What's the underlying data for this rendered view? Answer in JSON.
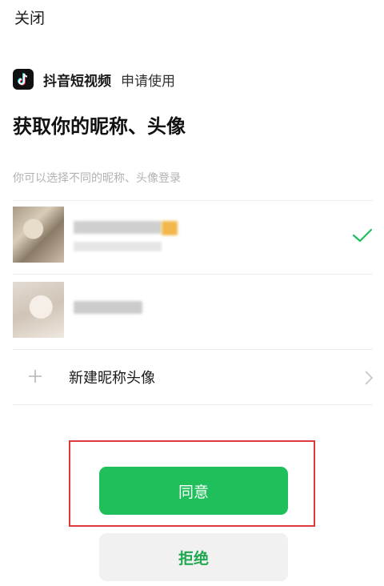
{
  "header": {
    "close_label": "关闭"
  },
  "app": {
    "name": "抖音短视频",
    "request_text": "申请使用",
    "logo_icon": "tiktok-logo-icon"
  },
  "page": {
    "title": "获取你的昵称、头像",
    "subtitle": "你可以选择不同的昵称、头像登录"
  },
  "accounts": [
    {
      "selected": true
    },
    {
      "selected": false
    }
  ],
  "new_option": {
    "label": "新建昵称头像",
    "icon": "plus-icon"
  },
  "buttons": {
    "agree": "同意",
    "reject": "拒绝"
  },
  "colors": {
    "accent": "#1fc05b",
    "highlight": "#e0393b"
  }
}
